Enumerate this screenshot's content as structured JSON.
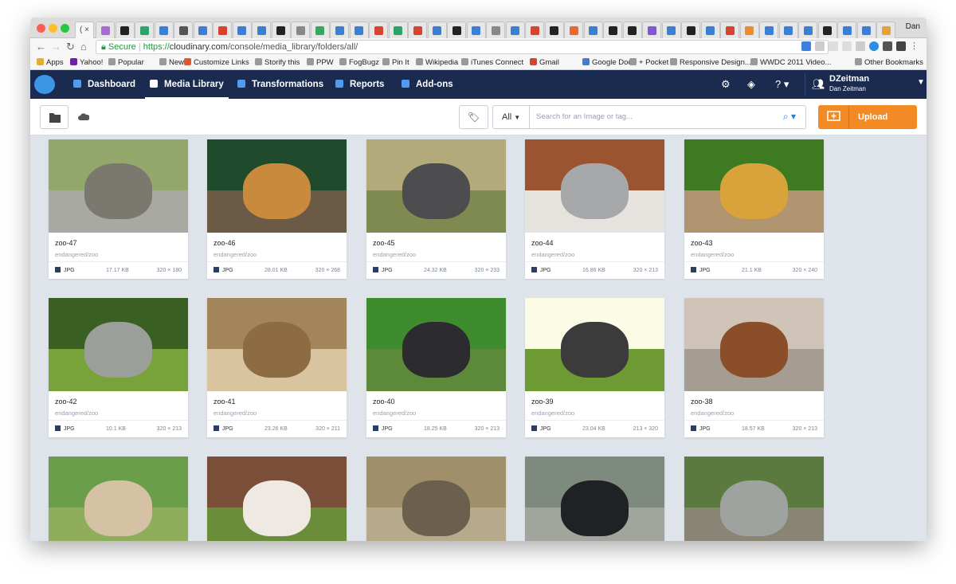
{
  "browser": {
    "tab_label": "( ×",
    "user": "Dan",
    "url": {
      "scheme": "https://",
      "host": "cloudinary.com",
      "path": "/console/media_library/folders/all/",
      "secure_label": "Secure"
    },
    "bookmarks": [
      "Apps",
      "Yahoo!",
      "Popular",
      "News",
      "Customize Links",
      "Storify this",
      "PPW",
      "FogBugz",
      "Pin It",
      "Wikipedia",
      "iTunes Connect",
      "Gmail",
      "Google Docs",
      "+ Pocket",
      "Responsive Design...",
      "WWDC 2011 Video...",
      "Other Bookmarks"
    ],
    "colors": {
      "tab_icons": [
        "#a86bd6",
        "#222",
        "#2ca36b",
        "#3a7fd5",
        "#555",
        "#3a7fd5",
        "#d8432f",
        "#3a7fd5",
        "#3a7fd5",
        "#222",
        "#888",
        "#3aa55f",
        "#3a7fd5",
        "#3a7fd5",
        "#d8432f",
        "#2ca36b",
        "#d8432f",
        "#3a7fd5",
        "#222",
        "#3a7fd5",
        "#888",
        "#3a7fd5",
        "#d8432f",
        "#222",
        "#e86a2a",
        "#3a7fd5",
        "#222",
        "#222",
        "#8055d8",
        "#3a7fd5",
        "#222",
        "#3a7fd5",
        "#d8432f",
        "#f08a2a",
        "#3a7fd5",
        "#3a7fd5",
        "#3a7fd5",
        "#222",
        "#3a7fd5",
        "#3a7fd5",
        "#e8a030",
        "#3b5998",
        "#3a7fd5",
        "#3a7fd5",
        "#222",
        "#3a7fd5",
        "#d8432f",
        "#222"
      ]
    }
  },
  "app": {
    "nav": {
      "dashboard": "Dashboard",
      "media_library": "Media Library",
      "transformations": "Transformations",
      "reports": "Reports",
      "addons": "Add-ons"
    },
    "user": {
      "name": "DZeitman",
      "full_name": "Dan Zeitman"
    },
    "search": {
      "filter": "All",
      "placeholder": "Search for an Image or tag..."
    },
    "upload_label": "Upload",
    "colors": {
      "nav_bg": "#1a2b4f",
      "accent": "#f28a26",
      "link": "#2b7ad6"
    }
  },
  "assets": [
    {
      "name": "zoo-47",
      "folder": "endangered/zoo",
      "format": "JPG",
      "size": "17.17 KB",
      "dims": "320 × 180",
      "palette": [
        "#93a86a",
        "#a9a9a4",
        "#7b7870"
      ]
    },
    {
      "name": "zoo-46",
      "folder": "endangered/zoo",
      "format": "JPG",
      "size": "28.01 KB",
      "dims": "320 × 268",
      "palette": [
        "#1f4a2c",
        "#6b5a46",
        "#c98a3d"
      ]
    },
    {
      "name": "zoo-45",
      "folder": "endangered/zoo",
      "format": "JPG",
      "size": "24.32 KB",
      "dims": "320 × 233",
      "palette": [
        "#b2aa7b",
        "#7f8a50",
        "#4d4d50"
      ]
    },
    {
      "name": "zoo-44",
      "folder": "endangered/zoo",
      "format": "JPG",
      "size": "16.86 KB",
      "dims": "320 × 213",
      "palette": [
        "#9a5530",
        "#e6e3de",
        "#a7a8aa"
      ]
    },
    {
      "name": "zoo-43",
      "folder": "endangered/zoo",
      "format": "JPG",
      "size": "21.1 KB",
      "dims": "320 × 240",
      "palette": [
        "#3d7a22",
        "#b19571",
        "#d7a33a"
      ]
    },
    {
      "name": "zoo-42",
      "folder": "endangered/zoo",
      "format": "JPG",
      "size": "10.1 KB",
      "dims": "320 × 213",
      "palette": [
        "#3a5f22",
        "#77a33a",
        "#9aa099"
      ]
    },
    {
      "name": "zoo-41",
      "folder": "endangered/zoo",
      "format": "JPG",
      "size": "23.26 KB",
      "dims": "320 × 211",
      "palette": [
        "#a2855b",
        "#d8c49f",
        "#8d6c43"
      ]
    },
    {
      "name": "zoo-40",
      "folder": "endangered/zoo",
      "format": "JPG",
      "size": "18.25 KB",
      "dims": "320 × 213",
      "palette": [
        "#3f8c2f",
        "#5c8a3a",
        "#2b2b30"
      ]
    },
    {
      "name": "zoo-39",
      "folder": "endangered/zoo",
      "format": "JPG",
      "size": "23.04 KB",
      "dims": "213 × 320",
      "palette": [
        "#fbfbe6",
        "#6d9a33",
        "#3b3b3b"
      ]
    },
    {
      "name": "zoo-38",
      "folder": "endangered/zoo",
      "format": "JPG",
      "size": "18.57 KB",
      "dims": "320 × 213",
      "palette": [
        "#cfc4b7",
        "#a59d91",
        "#8a4f2a"
      ]
    },
    {
      "name": "",
      "folder": "",
      "format": "",
      "size": "",
      "dims": "",
      "palette": [
        "#6a9e4b",
        "#8fae5c",
        "#d5c2a5"
      ]
    },
    {
      "name": "",
      "folder": "",
      "format": "",
      "size": "",
      "dims": "",
      "palette": [
        "#7b4e3a",
        "#6a8d3a",
        "#eeeae3"
      ]
    },
    {
      "name": "",
      "folder": "",
      "format": "",
      "size": "",
      "dims": "",
      "palette": [
        "#a08f6a",
        "#b7a98c",
        "#6a604d"
      ]
    },
    {
      "name": "",
      "folder": "",
      "format": "",
      "size": "",
      "dims": "",
      "palette": [
        "#7d8a7d",
        "#a2a49e",
        "#1f2125"
      ]
    },
    {
      "name": "",
      "folder": "",
      "format": "",
      "size": "",
      "dims": "",
      "palette": [
        "#5b7a3f",
        "#8a8475",
        "#9ea3a0"
      ]
    }
  ]
}
